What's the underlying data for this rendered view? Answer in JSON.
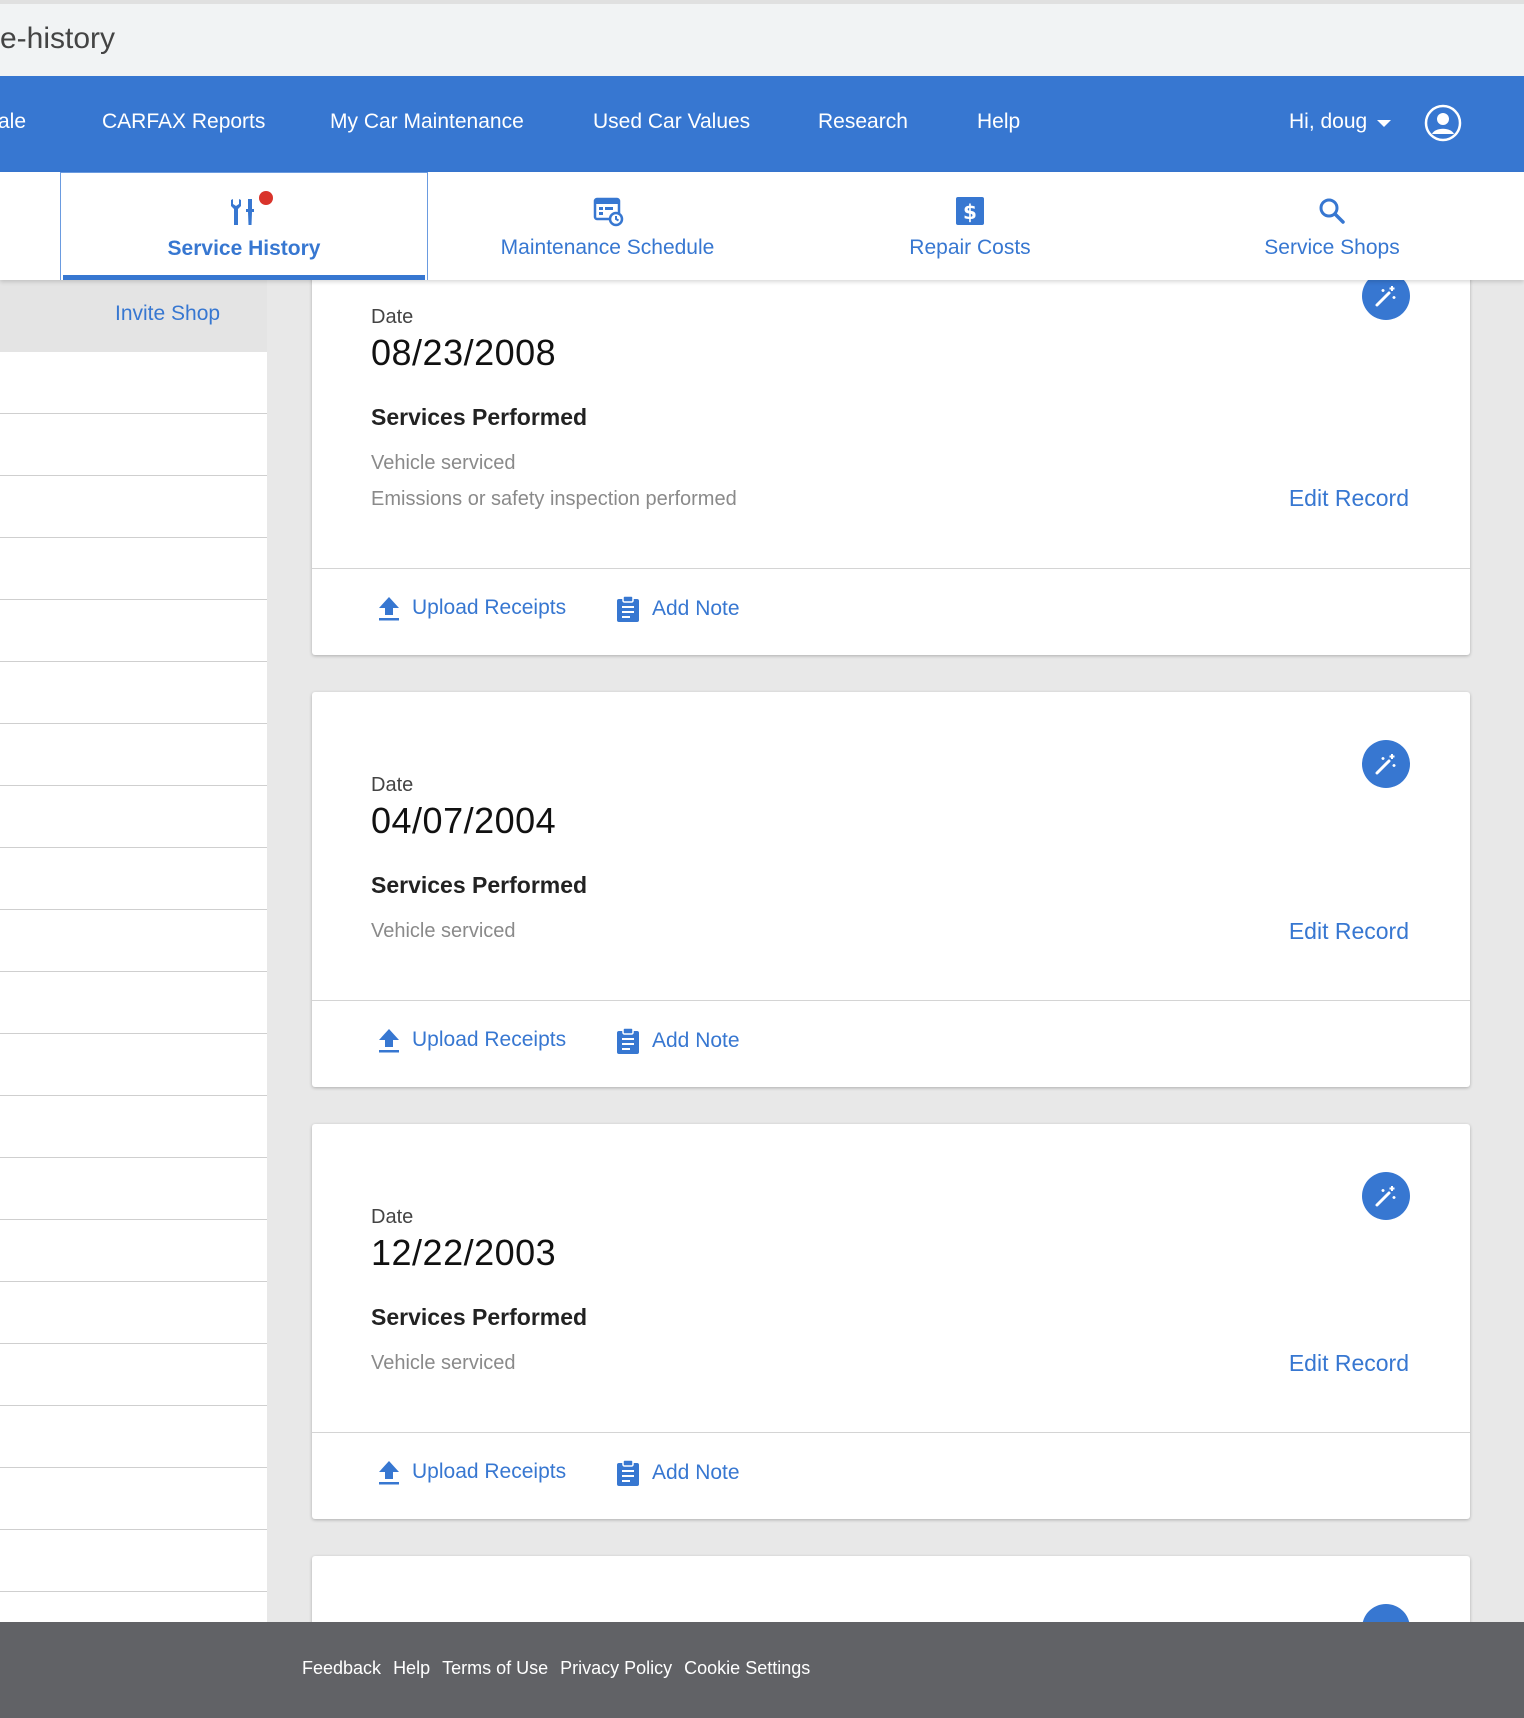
{
  "browser": {
    "url_fragment": "e-history"
  },
  "topnav": {
    "items": [
      "ale",
      "CARFAX Reports",
      "My Car Maintenance",
      "Used Car Values",
      "Research",
      "Help"
    ],
    "user_greeting": "Hi, doug"
  },
  "subnav": {
    "tabs": [
      {
        "label": "Service History",
        "icon": "wrench-screwdriver-icon",
        "active": true,
        "notification": true
      },
      {
        "label": "Maintenance Schedule",
        "icon": "calendar-clock-icon",
        "active": false
      },
      {
        "label": "Repair Costs",
        "icon": "dollar-icon",
        "active": false
      },
      {
        "label": "Service Shops",
        "icon": "search-icon",
        "active": false
      }
    ]
  },
  "sidebar": {
    "invite_label": "Invite Shop"
  },
  "records": [
    {
      "date_label": "Date",
      "date": "08/23/2008",
      "services_title": "Services Performed",
      "services": [
        "Vehicle serviced",
        "Emissions or safety inspection performed"
      ],
      "edit_label": "Edit Record",
      "upload_label": "Upload Receipts",
      "note_label": "Add Note"
    },
    {
      "date_label": "Date",
      "date": "04/07/2004",
      "services_title": "Services Performed",
      "services": [
        "Vehicle serviced"
      ],
      "edit_label": "Edit Record",
      "upload_label": "Upload Receipts",
      "note_label": "Add Note"
    },
    {
      "date_label": "Date",
      "date": "12/22/2003",
      "services_title": "Services Performed",
      "services": [
        "Vehicle serviced"
      ],
      "edit_label": "Edit Record",
      "upload_label": "Upload Receipts",
      "note_label": "Add Note"
    }
  ],
  "footer": {
    "links": [
      "Feedback",
      "Help",
      "Terms of Use",
      "Privacy Policy",
      "Cookie Settings"
    ]
  },
  "colors": {
    "brand": "#3777d1",
    "notification": "#d9342b",
    "footer_bg": "#616266"
  }
}
